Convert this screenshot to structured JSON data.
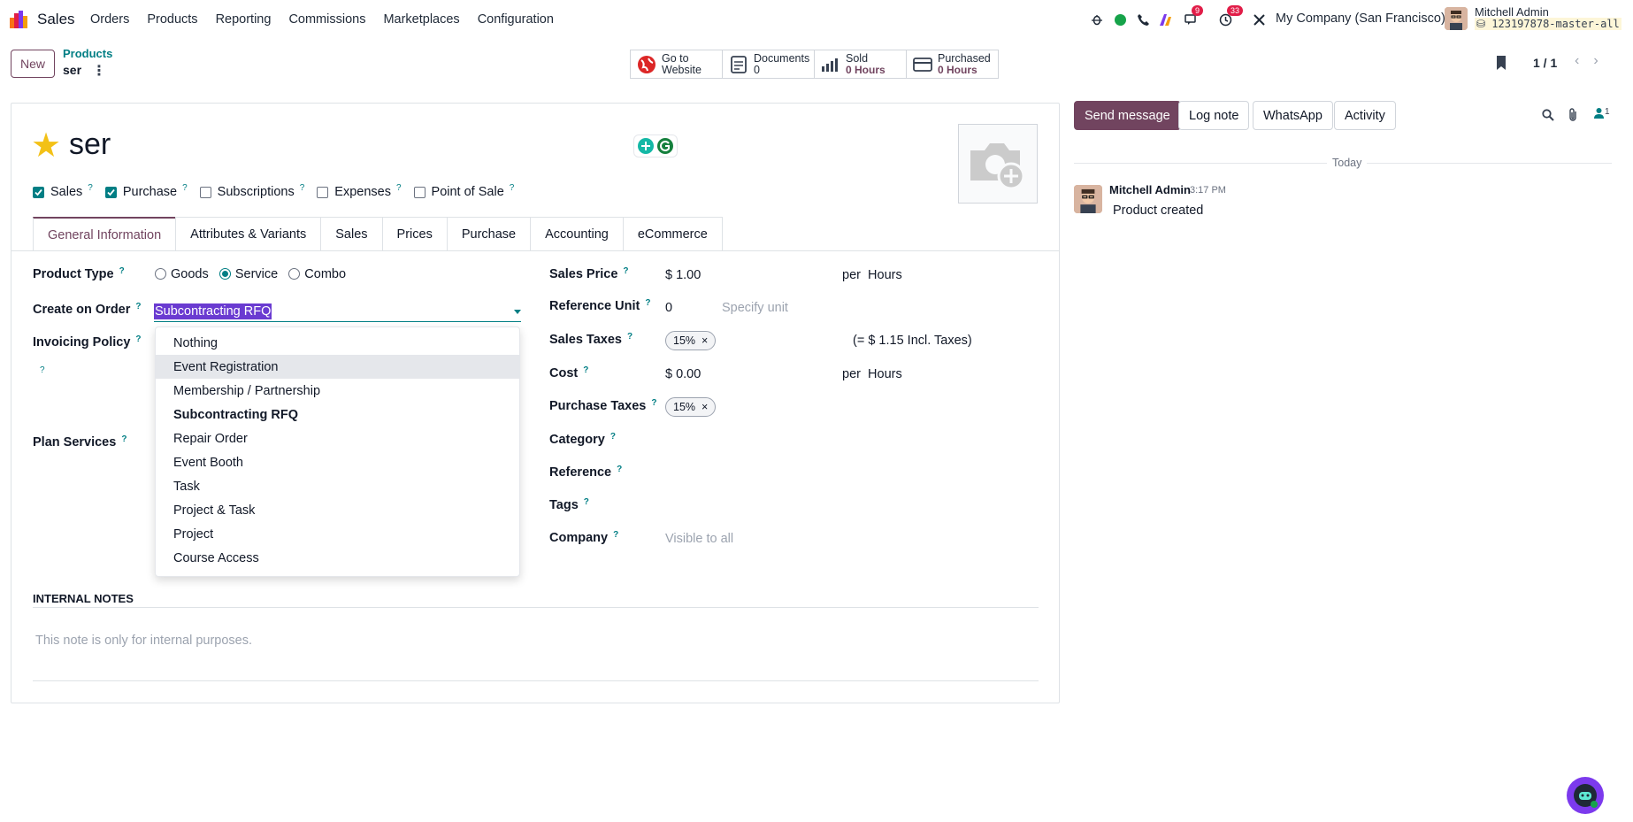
{
  "topbar": {
    "app_name": "Sales",
    "menu": [
      "Orders",
      "Products",
      "Reporting",
      "Commissions",
      "Marketplaces",
      "Configuration"
    ],
    "messages_count": "9",
    "activities_count": "33",
    "company": "My Company (San Francisco)",
    "user_name": "Mitchell Admin",
    "db_name": "123197878-master-all"
  },
  "control": {
    "new_label": "New",
    "breadcrumb_parent": "Products",
    "breadcrumb_current": "ser",
    "pager": "1 / 1"
  },
  "smart_buttons": [
    {
      "line1": "Go to",
      "line2": "Website"
    },
    {
      "line1": "Documents",
      "line2": "0"
    },
    {
      "line1": "Sold",
      "line2": "0 Hours"
    },
    {
      "line1": "Purchased",
      "line2": "0 Hours"
    }
  ],
  "product": {
    "name": "ser",
    "checkboxes": [
      {
        "label": "Sales",
        "checked": true
      },
      {
        "label": "Purchase",
        "checked": true
      },
      {
        "label": "Subscriptions",
        "checked": false
      },
      {
        "label": "Expenses",
        "checked": false
      },
      {
        "label": "Point of Sale",
        "checked": false
      }
    ],
    "tabs": [
      "General Information",
      "Attributes & Variants",
      "Sales",
      "Prices",
      "Purchase",
      "Accounting",
      "eCommerce"
    ]
  },
  "form": {
    "product_type_label": "Product Type",
    "product_type_options": [
      "Goods",
      "Service",
      "Combo"
    ],
    "create_on_order_label": "Create on Order",
    "create_on_order_value": "Subcontracting RFQ",
    "invoicing_policy_label": "Invoicing Policy",
    "plan_services_label": "Plan Services",
    "sales_price_label": "Sales Price",
    "sales_price": "$ 1.00",
    "per": "per",
    "uom": "Hours",
    "reference_unit_label": "Reference Unit",
    "reference_unit": "0",
    "reference_unit_placeholder": "Specify unit",
    "sales_taxes_label": "Sales Taxes",
    "sales_tax_tag": "15%",
    "incl_taxes": "(= $ 1.15 Incl. Taxes)",
    "cost_label": "Cost",
    "cost": "$ 0.00",
    "purchase_taxes_label": "Purchase Taxes",
    "purchase_tax_tag": "15%",
    "category_label": "Category",
    "reference_label": "Reference",
    "tags_label": "Tags",
    "company_label": "Company",
    "company_placeholder": "Visible to all",
    "help_mark": "?",
    "tag_remove": "×"
  },
  "dropdown": {
    "options": [
      "Nothing",
      "Event Registration",
      "Membership / Partnership",
      "Subcontracting RFQ",
      "Repair Order",
      "Event Booth",
      "Task",
      "Project & Task",
      "Project",
      "Course Access"
    ],
    "highlighted": "Event Registration",
    "selected": "Subcontracting RFQ"
  },
  "notes": {
    "title": "INTERNAL NOTES",
    "placeholder": "This note is only for internal purposes."
  },
  "chatter": {
    "send_message": "Send message",
    "log_note": "Log note",
    "whatsapp": "WhatsApp",
    "activity": "Activity",
    "followers_count": "1",
    "today": "Today",
    "author": "Mitchell Admin",
    "time": "3:17 PM",
    "body": "Product created"
  },
  "colors": {
    "brand": "#71445f",
    "teal": "#017e84",
    "selection": "#6a3bd1"
  }
}
